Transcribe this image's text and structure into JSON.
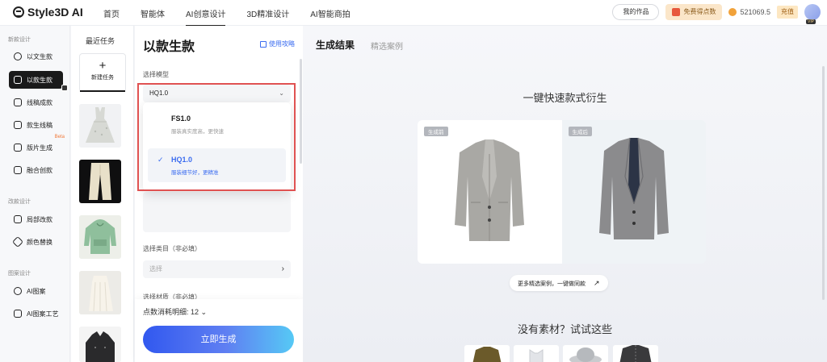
{
  "brand": {
    "logo_text": "Style3D AI"
  },
  "topnav": {
    "items": [
      "首页",
      "智能体",
      "AI创意设计",
      "3D精准设计",
      "AI智能商拍"
    ],
    "active_index": 2
  },
  "topbar": {
    "my_works": "我的作品",
    "free_points": "免费得点数",
    "points": "521069.5",
    "recharge": "充值",
    "vip": "VIP"
  },
  "sidebar": {
    "sections": [
      {
        "title": "新款设计",
        "items": [
          "以文生款",
          "以款生款",
          "线稿成款",
          "款生线稿",
          "版片生成",
          "融合创款"
        ]
      },
      {
        "title": "改款设计",
        "items": [
          "局部改款",
          "颜色替换"
        ]
      },
      {
        "title": "图案设计",
        "items": [
          "AI图案",
          "AI图案工艺"
        ]
      }
    ],
    "active_item": "以款生款",
    "beta_label": "Beta"
  },
  "recent": {
    "title": "最近任务",
    "new_task_label": "新建任务"
  },
  "panel": {
    "title": "以款生款",
    "guide_link": "使用攻略",
    "model_label": "选择模型",
    "model_value": "HQ1.0",
    "model_options": [
      {
        "name": "FS1.0",
        "desc": "服装真实度高，更快速",
        "selected": false
      },
      {
        "name": "HQ1.0",
        "desc": "服装细节好，更精准",
        "selected": true
      }
    ],
    "category_label": "选择类目（非必填）",
    "category_placeholder": "选择",
    "material_label": "选择材质（非必填）",
    "cost_label": "点数消耗明细: 12",
    "generate_button": "立即生成"
  },
  "results": {
    "tabs": [
      "生成结果",
      "精选案例"
    ],
    "hero_title": "一键快速款式衍生",
    "before_tag": "生成前",
    "after_tag": "生成后",
    "more_cases": "更多精选案例，一键做同款",
    "no_material_title": "没有素材？试试这些"
  },
  "colors": {
    "accent": "#3b6cf0",
    "dark": "#1a1a1a",
    "highlight_box": "#e05252"
  }
}
